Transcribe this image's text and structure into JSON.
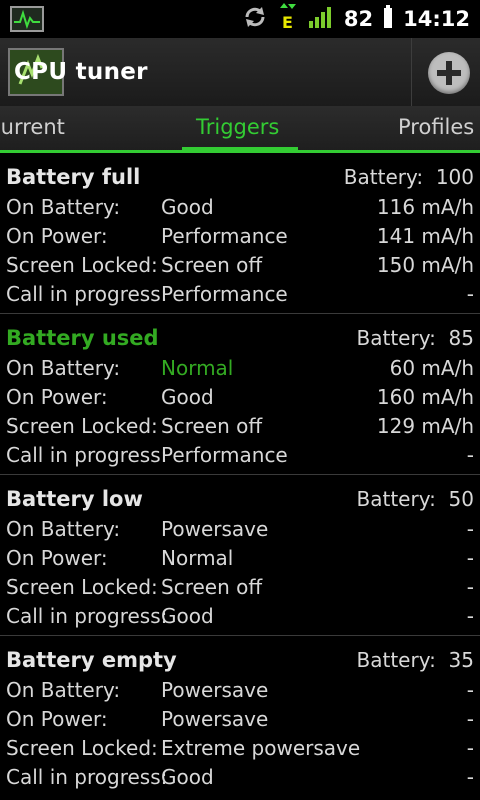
{
  "status": {
    "battery": "82",
    "time": "14:12",
    "network": "E"
  },
  "app": {
    "title": "CPU tuner"
  },
  "tabs": [
    {
      "label": "Current"
    },
    {
      "label": "Triggers"
    },
    {
      "label": "Profiles"
    }
  ],
  "labels": {
    "on_battery": "On Battery:",
    "on_power": "On Power:",
    "screen_locked": "Screen Locked:",
    "call": "Call in progress:",
    "battery": "Battery:"
  },
  "triggers": [
    {
      "name": "Battery full",
      "battery": "100",
      "rows": [
        {
          "profile": "Good",
          "current": "116 mA/h"
        },
        {
          "profile": "Performance",
          "current": "141 mA/h"
        },
        {
          "profile": "Screen off",
          "current": "150 mA/h"
        },
        {
          "profile": "Performance",
          "current": "-"
        }
      ]
    },
    {
      "name": "Battery used",
      "battery": "85",
      "rows": [
        {
          "profile": "Normal",
          "current": "60 mA/h"
        },
        {
          "profile": "Good",
          "current": "160 mA/h"
        },
        {
          "profile": "Screen off",
          "current": "129 mA/h"
        },
        {
          "profile": "Performance",
          "current": "-"
        }
      ]
    },
    {
      "name": "Battery low",
      "battery": "50",
      "rows": [
        {
          "profile": "Powersave",
          "current": "-"
        },
        {
          "profile": "Normal",
          "current": "-"
        },
        {
          "profile": "Screen off",
          "current": "-"
        },
        {
          "profile": "Good",
          "current": "-"
        }
      ]
    },
    {
      "name": "Battery empty",
      "battery": "35",
      "rows": [
        {
          "profile": "Powersave",
          "current": "-"
        },
        {
          "profile": "Powersave",
          "current": "-"
        },
        {
          "profile": "Extreme powersave",
          "current": "-"
        },
        {
          "profile": "Good",
          "current": "-"
        }
      ]
    }
  ],
  "colors": {
    "accent": "#33cc33",
    "active_trigger": "#33aa22"
  }
}
